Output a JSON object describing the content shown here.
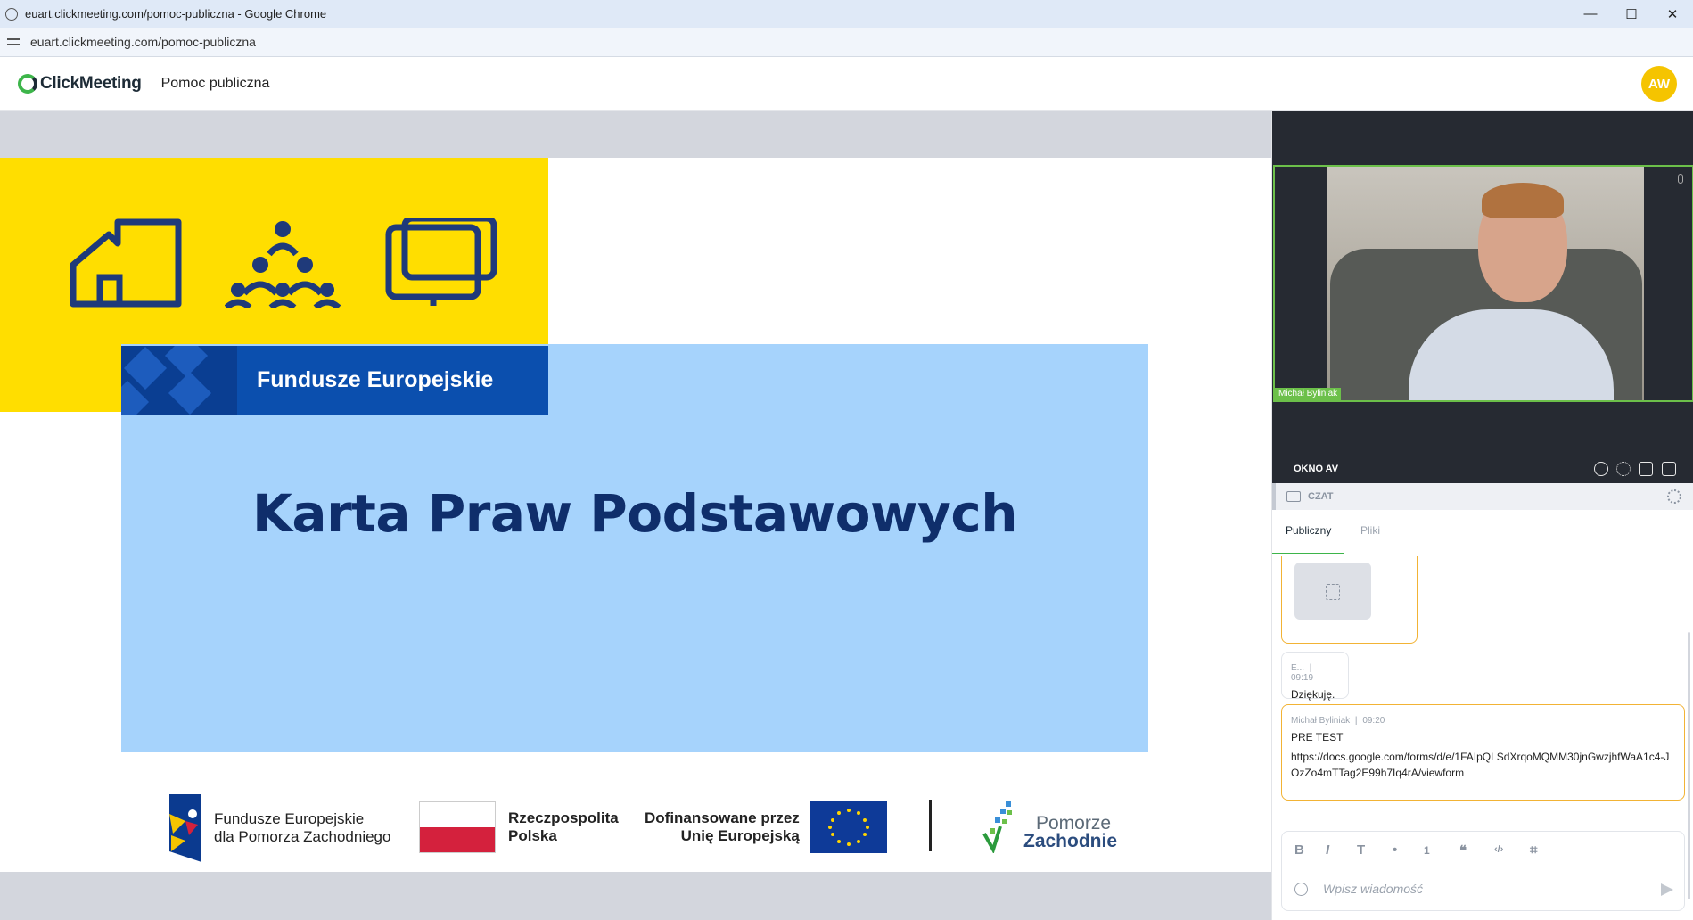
{
  "window": {
    "title": "euart.clickmeeting.com/pomoc-publiczna - Google Chrome",
    "minimize": "—",
    "maximize": "☐",
    "close": "✕"
  },
  "address": {
    "url": "euart.clickmeeting.com/pomoc-publiczna"
  },
  "header": {
    "logo_text": "ClickMeeting",
    "room_title": "Pomoc publiczna",
    "avatar_initials": "AW",
    "avatar_color": "#f5c400"
  },
  "slide": {
    "band_label": "Fundusze Europejskie",
    "headline": "Karta Praw Podstawowych",
    "colors": {
      "yellow": "#ffde00",
      "light_blue": "#a6d3fc",
      "navy": "#0f2e6b"
    },
    "icons": [
      "house-icon",
      "people-icon",
      "book-icon"
    ],
    "footer": {
      "fe_line1": "Fundusze Europejskie",
      "fe_line2": "dla Pomorza Zachodniego",
      "rp_line1": "Rzeczpospolita",
      "rp_line2": "Polska",
      "eu_line1": "Dofinansowane przez",
      "eu_line2": "Unię Europejską",
      "pz_line1": "Pomorze",
      "pz_line2": "Zachodnie"
    }
  },
  "av_window": {
    "participant_name": "Michał Byliniak",
    "label": "OKNO AV",
    "controls": [
      "chat-bubble-icon",
      "settings-icon",
      "expand-icon",
      "popout-icon"
    ]
  },
  "chat": {
    "header_label": "CZAT",
    "tabs": [
      {
        "label": "Publiczny",
        "active": true
      },
      {
        "label": "Pliki",
        "active": false
      }
    ],
    "messages": [
      {
        "author": "E...",
        "time": "09:19",
        "text": "Dziękuję."
      },
      {
        "author": "Michał Byliniak",
        "time": "09:20",
        "text": "PRE TEST",
        "link": "https://docs.google.com/forms/d/e/1FAIpQLSdXrqoMQMM30jnGwzjhfWaA1c4-JOzZo4mTTag2E99h7Iq4rA/viewform"
      }
    ],
    "separator": "|",
    "composer": {
      "placeholder": "Wpisz wiadomość",
      "format_buttons": [
        "B",
        "I",
        "T",
        "•",
        "1",
        "❝",
        "‹/›",
        "⌗"
      ]
    }
  }
}
